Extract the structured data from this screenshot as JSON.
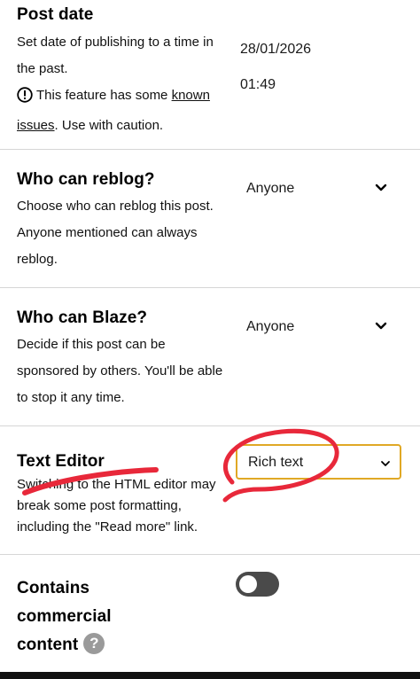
{
  "post_date": {
    "title": "Post date",
    "desc_line1": "Set date of publishing to a time in",
    "desc_line2": "the past.",
    "warning_text": "This feature has some ",
    "warning_link": "known",
    "warning_link2": "issues",
    "warning_suffix": ". Use with caution.",
    "date_value": "28/01/2026",
    "time_value": "01:49"
  },
  "reblog": {
    "title": "Who can reblog?",
    "desc_line1": "Choose who can reblog this post.",
    "desc_line2": "Anyone mentioned can always",
    "desc_line3": "reblog.",
    "value": "Anyone"
  },
  "blaze": {
    "title": "Who can Blaze?",
    "desc_line1": "Decide if this post can be",
    "desc_line2": "sponsored by others. You'll be able",
    "desc_line3": "to stop it any time.",
    "value": "Anyone"
  },
  "text_editor": {
    "title": "Text Editor",
    "desc_line1": "Switching to the HTML editor may",
    "desc_line2": "break some post formatting,",
    "desc_line3": "including the \"Read more\" link.",
    "value": "Rich text",
    "accent": "#e0a825"
  },
  "commercial": {
    "title_line1": "Contains",
    "title_line2": "commercial",
    "title_line3": "content",
    "help_glyph": "?",
    "toggle_on": false
  },
  "annotation_color": "#e8283a"
}
